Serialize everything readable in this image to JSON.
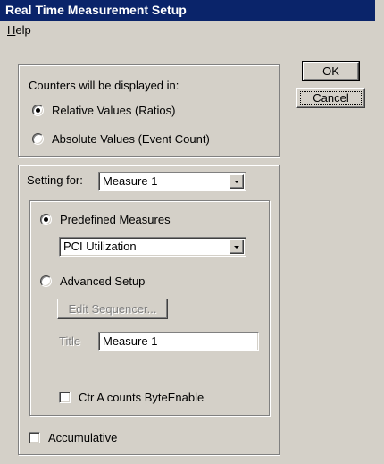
{
  "window": {
    "title": "Real Time Measurement Setup"
  },
  "menu": {
    "help_prefix": "H",
    "help_rest": "elp"
  },
  "buttons": {
    "ok": "OK",
    "cancel": "Cancel"
  },
  "display_group": {
    "heading": "Counters will be displayed in:",
    "options": [
      {
        "label": "Relative Values (Ratios)",
        "selected": true
      },
      {
        "label": "Absolute Values (Event Count)",
        "selected": false
      }
    ]
  },
  "setting": {
    "label": "Setting for:",
    "selected": "Measure 1"
  },
  "measure_group": {
    "predefined_label": "Predefined Measures",
    "predefined_selected": true,
    "predefined_value": "PCI Utilization",
    "advanced_label": "Advanced Setup",
    "advanced_selected": false,
    "edit_sequencer_label": "Edit Sequencer...",
    "title_label": "Title",
    "title_value": "Measure 1",
    "ctr_label": "Ctr A counts ByteEnable",
    "ctr_checked": false
  },
  "accumulative": {
    "label": "Accumulative",
    "checked": false
  },
  "icons": {
    "radio": "radio-button-icon",
    "combo": "chevron-down-icon"
  }
}
